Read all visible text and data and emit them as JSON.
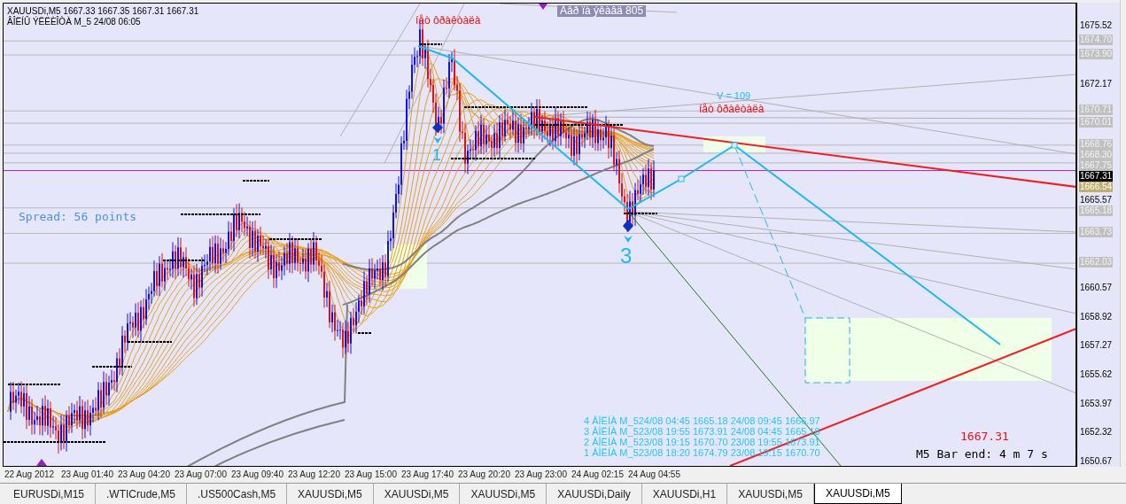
{
  "chart": {
    "symbol_line": "XAUUSDi,M5  1667.33 1667.35 1667.31 1667.31",
    "indicator_line": "ÂÎËÍÛ ÝËËÈÎÒÀ M_5 24/08 06:05",
    "labels": [
      {
        "kind": "top_note",
        "text": "íåò ôðàêòàëà"
      },
      {
        "kind": "top_right_note",
        "text": "Àâð ïà ýêàâä 805"
      },
      {
        "kind": "volume",
        "text": "V = 109"
      },
      {
        "kind": "fractal_note",
        "text": "íåò ôðàêòàëà"
      },
      {
        "kind": "spread",
        "text": "Spread: 56 points"
      },
      {
        "kind": "wave_small",
        "text": "1"
      },
      {
        "kind": "wave_big",
        "text": "3"
      },
      {
        "kind": "price",
        "text": "1667.31"
      },
      {
        "kind": "bar_timer",
        "text": "M5 Bar end: 4 m 7 s"
      }
    ],
    "wave_summary": [
      "4 ÂÎËÍÀ M_524/08 04:45 1665.18 24/08 09:45 1666.97",
      "3 ÂÎËÍÀ M_523/08 19:55 1673.91 24/08 04:45 1665.18",
      "2 ÂÎËÍÀ M_523/08 19:15 1670.70 23/08 19:55 1673.91",
      "1 ÂÎËÍÀ M_523/08 18:20 1674.79 23/08 19:15 1670.70"
    ]
  },
  "price_axis": {
    "ticks": [
      "1675.52",
      "1672.17",
      "1665.57",
      "1660.57",
      "1658.92",
      "1657.27",
      "1655.62",
      "1653.97",
      "1652.32",
      "1650.67"
    ],
    "levels": [
      "1674.70",
      "1673.90",
      "1670.71",
      "1670.01",
      "1668.76",
      "1668.30",
      "1667.75",
      "1665.18",
      "1663.73",
      "1662.03"
    ],
    "current": "1667.31",
    "trend_level": "1666.54"
  },
  "time_axis": [
    "22 Aug 2012",
    "23 Aug 01:40",
    "23 Aug 04:20",
    "23 Aug 07:00",
    "23 Aug 09:40",
    "23 Aug 12:20",
    "23 Aug 15:00",
    "23 Aug 17:40",
    "23 Aug 20:20",
    "23 Aug 23:00",
    "24 Aug 02:15",
    "24 Aug 04:55"
  ],
  "tabs": [
    {
      "label": "EURUSDi,M15",
      "selected": false
    },
    {
      "label": ".WTICrude,M5",
      "selected": false
    },
    {
      "label": ".US500Cash,M5",
      "selected": false
    },
    {
      "label": "XAUUSDi,M5",
      "selected": false
    },
    {
      "label": "XAUUSDi,M5",
      "selected": false
    },
    {
      "label": "XAUUSDi,M5",
      "selected": false
    },
    {
      "label": "XAUUSDi,Daily",
      "selected": false
    },
    {
      "label": "XAUUSDi,H1",
      "selected": false
    },
    {
      "label": "XAUUSDi,M5",
      "selected": false
    },
    {
      "label": "XAUUSDi,M5",
      "selected": true
    }
  ]
}
